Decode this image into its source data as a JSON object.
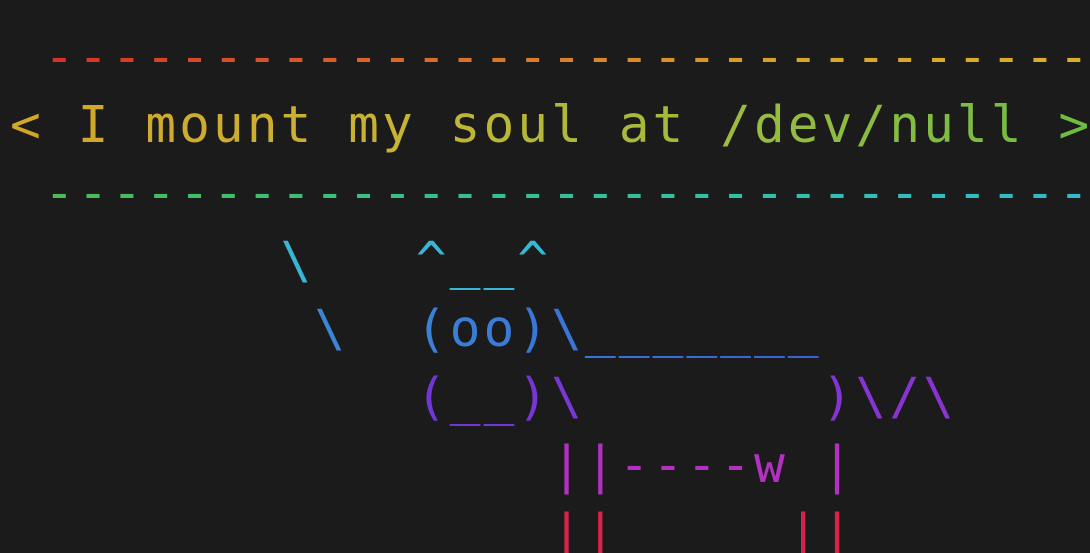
{
  "terminal": {
    "background": "#1b1b1b",
    "lines": [
      {
        "segments": [
          {
            "text": " ---------------------------------- ",
            "color": "#d8452e"
          }
        ]
      },
      {
        "segments": [
          {
            "text": "< I mount my soul at /dev/null >",
            "color": "#a7b63c"
          }
        ]
      },
      {
        "segments": [
          {
            "text": " ---------------------------------- ",
            "color": "#3bb59a"
          }
        ]
      },
      {
        "segments": [
          {
            "text": "        \\   ^__^",
            "color": "#3aa9c8"
          }
        ]
      },
      {
        "segments": [
          {
            "text": "         \\  (oo)\\_______",
            "color": "#3f74d3"
          }
        ]
      },
      {
        "segments": [
          {
            "text": "            (__)\\       )\\/\\",
            "color": "#7a37d6"
          }
        ]
      },
      {
        "segments": [
          {
            "text": "                ||----w |",
            "color": "#b330c2"
          }
        ]
      },
      {
        "segments": [
          {
            "text": "                ||     ||",
            "color": "#d8234b"
          }
        ]
      }
    ]
  },
  "colors": {
    "red": "#d8452e",
    "orange": "#d9862a",
    "yellow": "#c9b030",
    "green": "#6ebd45",
    "teal": "#36c0a0",
    "cyan": "#38b6d4",
    "blue": "#3a78d8",
    "violet": "#7a37d6",
    "magenta": "#b330c2",
    "crimson": "#d8234b"
  }
}
